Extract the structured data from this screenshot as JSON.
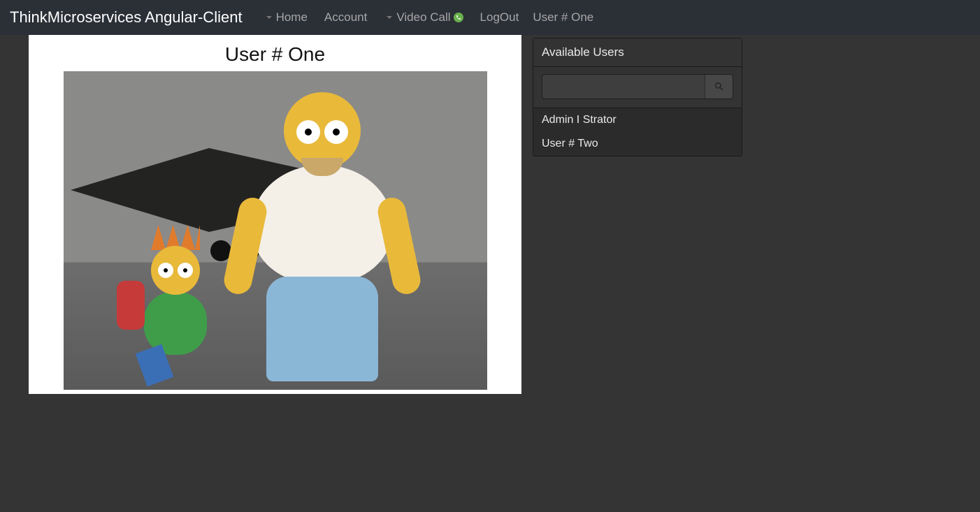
{
  "brand": "ThinkMicroservices Angular-Client",
  "nav": {
    "home": "Home",
    "account": "Account",
    "video_call": "Video Call",
    "logout": "LogOut",
    "current_user": "User # One"
  },
  "video": {
    "title": "User # One"
  },
  "side": {
    "header": "Available Users",
    "search_placeholder": "",
    "users": [
      "Admin I Strator",
      "User # Two"
    ]
  }
}
